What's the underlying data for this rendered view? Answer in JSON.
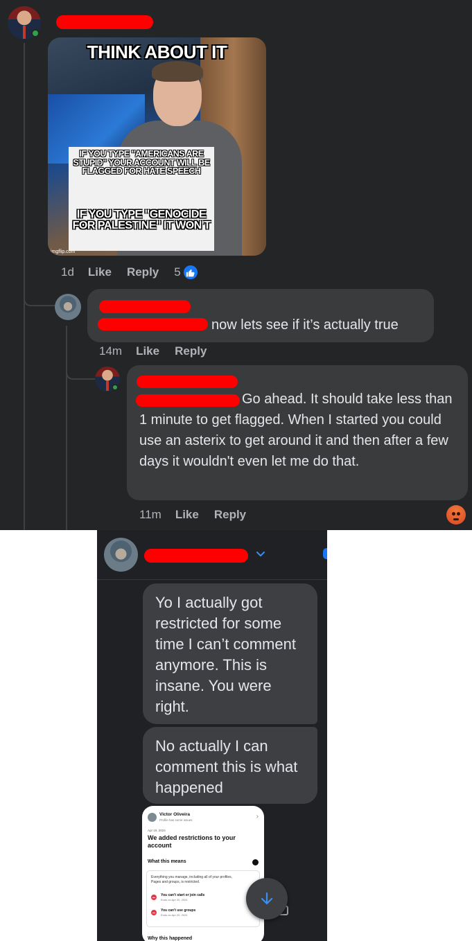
{
  "meme": {
    "title": "THINK ABOUT IT",
    "sign_top": "IF YOU TYPE \"AMERICANS ARE STUPID\" YOUR ACCOUNT WILL BE FLAGGED FOR HATE SPEECH",
    "sign_bottom": "IF YOU TYPE \"GENOCIDE FOR PALESTINE\" IT WON'T",
    "watermark": "imgflip.com"
  },
  "post": {
    "time": "1d",
    "like_label": "Like",
    "reply_label": "Reply",
    "reaction_count": "5"
  },
  "reply1": {
    "text": "now lets see if it’s actually true",
    "time": "14m",
    "like_label": "Like",
    "reply_label": "Reply"
  },
  "reply2": {
    "text": "Go ahead. It should take less than 1 minute to get flagged. When I started you could use an asterix to get around it and then after a few days it wouldn't even let me do that.",
    "time": "11m",
    "like_label": "Like",
    "reply_label": "Reply",
    "reaction": "angry-icon"
  },
  "messenger": {
    "messages": [
      "Yo I actually got restricted for some time I can’t comment anymore. This is insane. You were right.",
      "No actually I can comment this is what happened"
    ],
    "attachment": {
      "name": "Victor Oliveira",
      "subtitle": "Profile has some issues",
      "date": "Apr 19, 2024",
      "heading": "We added restrictions to your account",
      "what_label": "What this means",
      "explanation": "Everything you manage, including all of your profiles, Pages and groups, is restricted.",
      "restrictions": [
        {
          "title": "You can't start or join calls",
          "ends": "Ends on Apr 20, 2024"
        },
        {
          "title": "You can't use groups",
          "ends": "Ends on Apr 20, 2024"
        }
      ],
      "next_heading": "Why this happened"
    }
  },
  "colors": {
    "thread_bg": "#242526",
    "bubble_bg": "#3a3b3c",
    "text": "#e4e6eb",
    "muted": "#b0b3b8",
    "accent": "#1877f2",
    "redaction": "#ff0000"
  }
}
